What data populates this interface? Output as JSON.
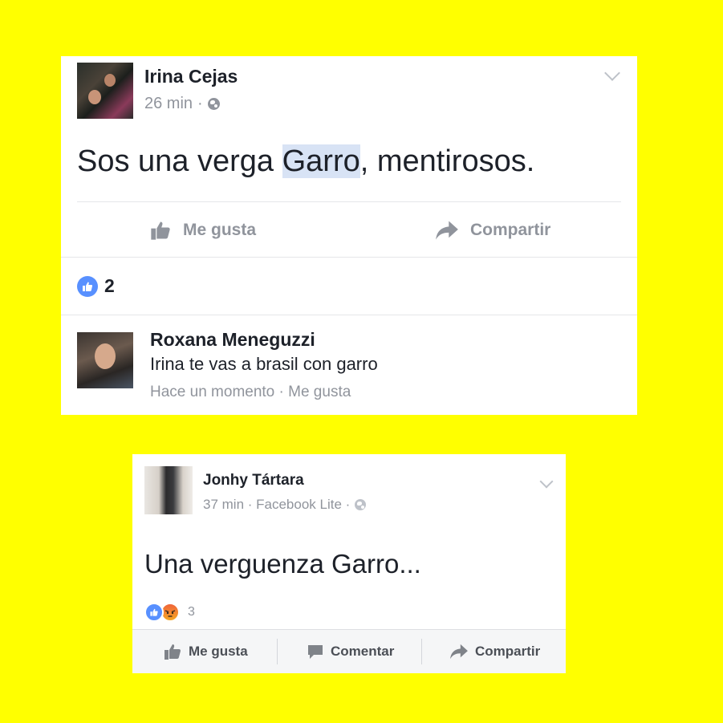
{
  "post1": {
    "author": "Irina Cejas",
    "time": "26 min",
    "meta_separator": "·",
    "privacy_icon": "globe-icon",
    "text_before": "Sos una verga ",
    "text_highlight": "Garro",
    "text_after": ", mentirosos.",
    "actions": {
      "like_label": "Me gusta",
      "share_label": "Compartir"
    },
    "reaction_count": "2",
    "comment": {
      "author": "Roxana Meneguzzi",
      "text": "Irina te vas a brasil con garro",
      "meta": "Hace un momento · Me gusta"
    }
  },
  "post2": {
    "author": "Jonhy Tártara",
    "meta": "37 min · Facebook Lite ·",
    "privacy_icon": "globe-icon",
    "text": "Una verguenza Garro...",
    "reactions": [
      "like",
      "angry"
    ],
    "reaction_count": "3",
    "actions": {
      "like_label": "Me gusta",
      "comment_label": "Comentar",
      "share_label": "Compartir"
    }
  },
  "colors": {
    "background": "#ffff00",
    "card": "#ffffff",
    "primary_text": "#1d2129",
    "secondary_text": "#90949c",
    "like_blue": "#5890ff",
    "highlight": "#d8e3f5"
  }
}
